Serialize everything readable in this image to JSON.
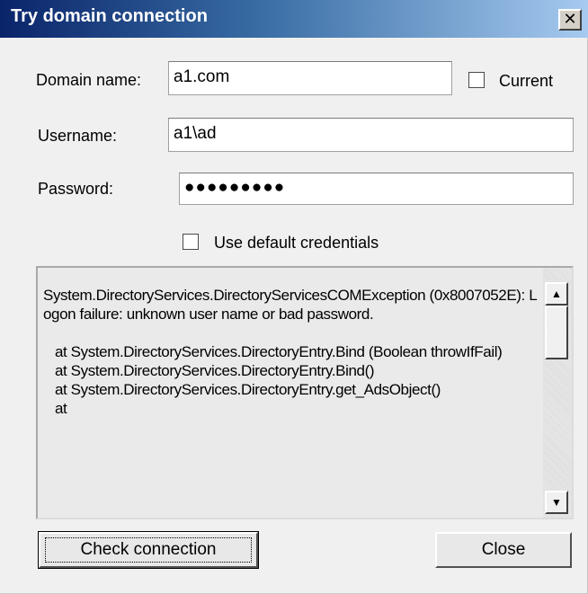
{
  "window": {
    "title": "Try domain connection",
    "close_glyph": "✕"
  },
  "form": {
    "domain_label": "Domain name:",
    "domain_value": "a1.com",
    "current_label": "Current",
    "username_label": "Username:",
    "username_value": "a1\\ad",
    "password_label": "Password:",
    "password_value": "●●●●●●●●●",
    "default_creds_label": "Use default credentials"
  },
  "log": {
    "text": "System.DirectoryServices.DirectoryServicesCOMException (0x8007052E): Logon failure: unknown user name or bad password.\n\n   at System.DirectoryServices.DirectoryEntry.Bind (Boolean throwIfFail)\n   at System.DirectoryServices.DirectoryEntry.Bind()\n   at System.DirectoryServices.DirectoryEntry.get_AdsObject()\n   at"
  },
  "buttons": {
    "check_label": "Check connection",
    "close_label": "Close"
  },
  "icons": {
    "scroll_up": "▲",
    "scroll_down": "▼"
  }
}
